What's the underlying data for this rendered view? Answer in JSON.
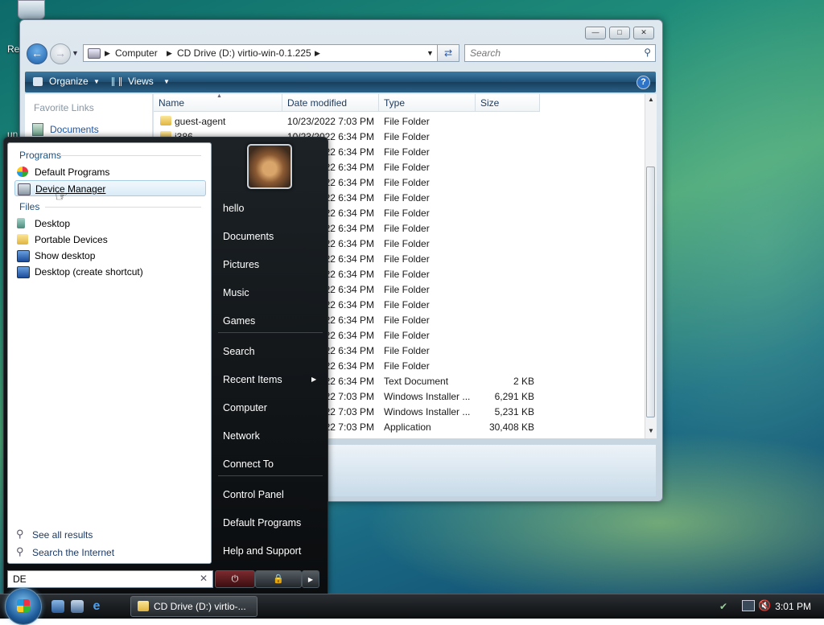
{
  "desktop": {
    "recycle_label": "Re",
    "partial_label": "un"
  },
  "explorer": {
    "address": {
      "computer": "Computer",
      "drive": "CD Drive (D:) virtio-win-0.1.225"
    },
    "search_placeholder": "Search",
    "toolbar": {
      "organize": "Organize",
      "views": "Views",
      "help": "?"
    },
    "nav": {
      "favorite_links": "Favorite Links",
      "documents": "Documents"
    },
    "columns": [
      "Name",
      "Date modified",
      "Type",
      "Size"
    ],
    "rows": [
      {
        "name": "guest-agent",
        "date": "10/23/2022 7:03 PM",
        "type": "File Folder",
        "size": ""
      },
      {
        "name": "i386",
        "date": "10/23/2022 6:34 PM",
        "type": "File Folder",
        "size": ""
      },
      {
        "name": "",
        "date": "22 6:34 PM",
        "type": "File Folder",
        "size": ""
      },
      {
        "name": "",
        "date": "22 6:34 PM",
        "type": "File Folder",
        "size": ""
      },
      {
        "name": "",
        "date": "22 6:34 PM",
        "type": "File Folder",
        "size": ""
      },
      {
        "name": "",
        "date": "22 6:34 PM",
        "type": "File Folder",
        "size": ""
      },
      {
        "name": "",
        "date": "22 6:34 PM",
        "type": "File Folder",
        "size": ""
      },
      {
        "name": "",
        "date": "22 6:34 PM",
        "type": "File Folder",
        "size": ""
      },
      {
        "name": "",
        "date": "22 6:34 PM",
        "type": "File Folder",
        "size": ""
      },
      {
        "name": "",
        "date": "22 6:34 PM",
        "type": "File Folder",
        "size": ""
      },
      {
        "name": "",
        "date": "22 6:34 PM",
        "type": "File Folder",
        "size": ""
      },
      {
        "name": "",
        "date": "22 6:34 PM",
        "type": "File Folder",
        "size": ""
      },
      {
        "name": "",
        "date": "22 6:34 PM",
        "type": "File Folder",
        "size": ""
      },
      {
        "name": "",
        "date": "22 6:34 PM",
        "type": "File Folder",
        "size": ""
      },
      {
        "name": "",
        "date": "22 6:34 PM",
        "type": "File Folder",
        "size": ""
      },
      {
        "name": "",
        "date": "22 6:34 PM",
        "type": "File Folder",
        "size": ""
      },
      {
        "name": "",
        "date": "22 6:34 PM",
        "type": "File Folder",
        "size": ""
      },
      {
        "name": "",
        "date": "22 6:34 PM",
        "type": "Text Document",
        "size": "2 KB"
      },
      {
        "name": "",
        "date": "22 7:03 PM",
        "type": "Windows Installer ...",
        "size": "6,291 KB"
      },
      {
        "name": "",
        "date": "22 7:03 PM",
        "type": "Windows Installer ...",
        "size": "5,231 KB"
      },
      {
        "name": "",
        "date": "22 7:03 PM",
        "type": "Application",
        "size": "30,408 KB"
      }
    ]
  },
  "start_menu": {
    "groups": {
      "programs": "Programs",
      "files": "Files"
    },
    "programs": [
      "Default Programs",
      "Device Manager"
    ],
    "files": [
      "Desktop",
      "Portable Devices",
      "Show desktop",
      "Desktop (create shortcut)"
    ],
    "see_all": "See all results",
    "search_internet": "Search the Internet",
    "search_value": "DE",
    "right_items": [
      "hello",
      "Documents",
      "Pictures",
      "Music",
      "Games",
      "Search",
      "Recent Items",
      "Computer",
      "Network",
      "Connect To",
      "Control Panel",
      "Default Programs",
      "Help and Support"
    ]
  },
  "taskbar": {
    "window_button": "CD Drive (D:) virtio-...",
    "clock": "3:01 PM"
  }
}
